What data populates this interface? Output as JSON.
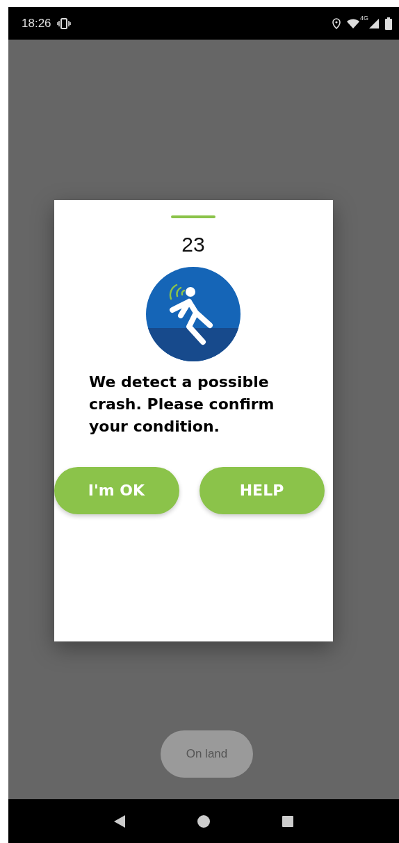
{
  "status_bar": {
    "time": "18:26",
    "network": "4G"
  },
  "dialog": {
    "countdown": "23",
    "message": "We detect a possible crash. Please confirm your condition.",
    "buttons": [
      {
        "label": "I'm OK"
      },
      {
        "label": "HELP"
      }
    ]
  },
  "background_button": {
    "label": "On land"
  }
}
